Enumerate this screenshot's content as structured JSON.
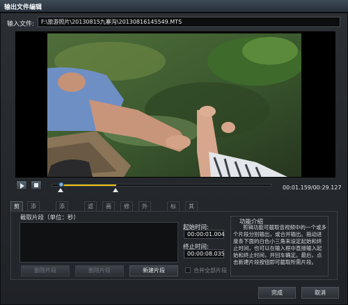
{
  "window": {
    "title": "输出文件编辑"
  },
  "input": {
    "label": "输入文件:",
    "path": "F:\\旅游照片\\20130815九寨沟\\20130816145549.MTS"
  },
  "player": {
    "time_readout": "00:01.159/00:29.127",
    "selection_start_fraction": 0.04,
    "selection_end_fraction": 0.29
  },
  "tabs": [
    {
      "label": "剪辑"
    },
    {
      "label": "添加文字"
    },
    {
      "label": "添加图片"
    },
    {
      "label": "滤镜"
    },
    {
      "label": "画质"
    },
    {
      "label": "修剪"
    },
    {
      "label": "外挂字幕"
    },
    {
      "label": "标准"
    },
    {
      "label": "其它"
    }
  ],
  "clip": {
    "segment_label": "截取片段（单位：秒）",
    "start_label": "起始时间:",
    "start_value": "00:00:01.004",
    "end_label": "终止时间:",
    "end_value": "00:00:08.035",
    "delete_button": "删除片段",
    "remove_button": "删除片段",
    "new_button": "新建片段",
    "merge_label": "合并全部片段"
  },
  "help": {
    "title": "功能介绍",
    "text": "剪辑功能可截取音视频中的一个或多个片段分别输出，或合并输出。拖动进度条下面的白色小三角来设定起始和终止时间，也可以在输入框中直接输入起始和终止时间，并回车确定。最后，点击新建片段按钮即可截取所需片段。"
  },
  "footer": {
    "ok": "完成",
    "cancel": "取消"
  },
  "colors": {
    "accent": "#f1c40f",
    "panel": "#23272b"
  }
}
